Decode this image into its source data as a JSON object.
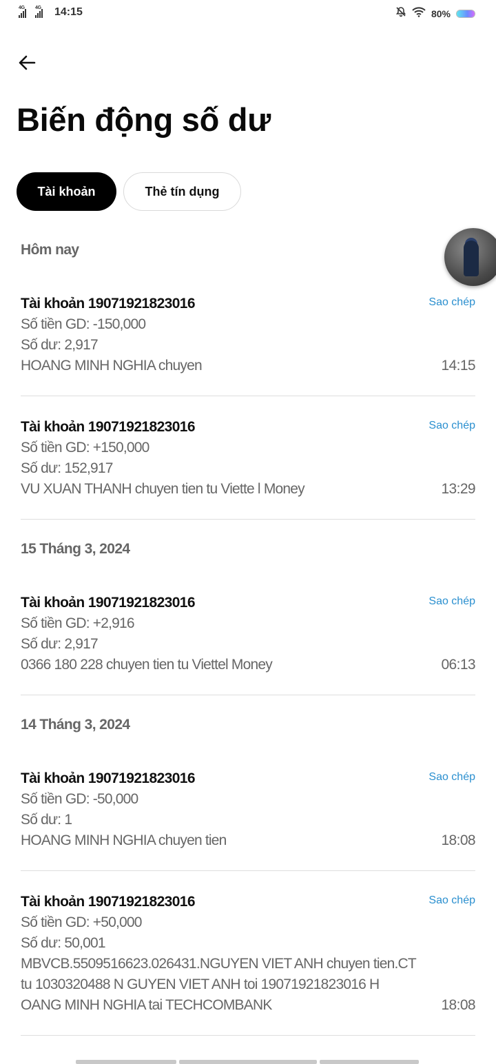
{
  "status_bar": {
    "network_1": "4G",
    "network_2": "4G",
    "time": "14:15",
    "battery": "80%"
  },
  "page": {
    "title": "Biến động số dư"
  },
  "tabs": [
    {
      "label": "Tài khoản",
      "active": true
    },
    {
      "label": "Thẻ tín dụng",
      "active": false
    }
  ],
  "copy_label": "Sao chép",
  "sections": [
    {
      "date": "Hôm nay",
      "transactions": [
        {
          "account": "Tài khoản 19071921823016",
          "amount": "Số tiền GD: -150,000",
          "balance": "Số dư: 2,917",
          "description": "HOANG MINH NGHIA chuyen",
          "time": "14:15"
        },
        {
          "account": "Tài khoản 19071921823016",
          "amount": "Số tiền GD: +150,000",
          "balance": "Số dư: 152,917",
          "description": "VU XUAN THANH chuyen tien tu Viette l Money",
          "time": "13:29"
        }
      ]
    },
    {
      "date": "15 Tháng 3, 2024",
      "transactions": [
        {
          "account": "Tài khoản 19071921823016",
          "amount": "Số tiền GD: +2,916",
          "balance": "Số dư: 2,917",
          "description": "0366 180 228 chuyen tien tu Viettel  Money",
          "time": "06:13"
        }
      ]
    },
    {
      "date": "14 Tháng 3, 2024",
      "transactions": [
        {
          "account": "Tài khoản 19071921823016",
          "amount": "Số tiền GD: -50,000",
          "balance": "Số dư: 1",
          "description": "HOANG MINH NGHIA chuyen tien",
          "time": "18:08"
        },
        {
          "account": "Tài khoản 19071921823016",
          "amount": "Số tiền GD: +50,000",
          "balance": "Số dư: 50,001",
          "description": "MBVCB.5509516623.026431.NGUYEN VIET  ANH chuyen tien.CT tu 1030320488 N GUYEN VIET ANH toi 19071921823016 H OANG MINH NGHIA tai TECHCOMBANK",
          "time": "18:08"
        }
      ]
    }
  ]
}
